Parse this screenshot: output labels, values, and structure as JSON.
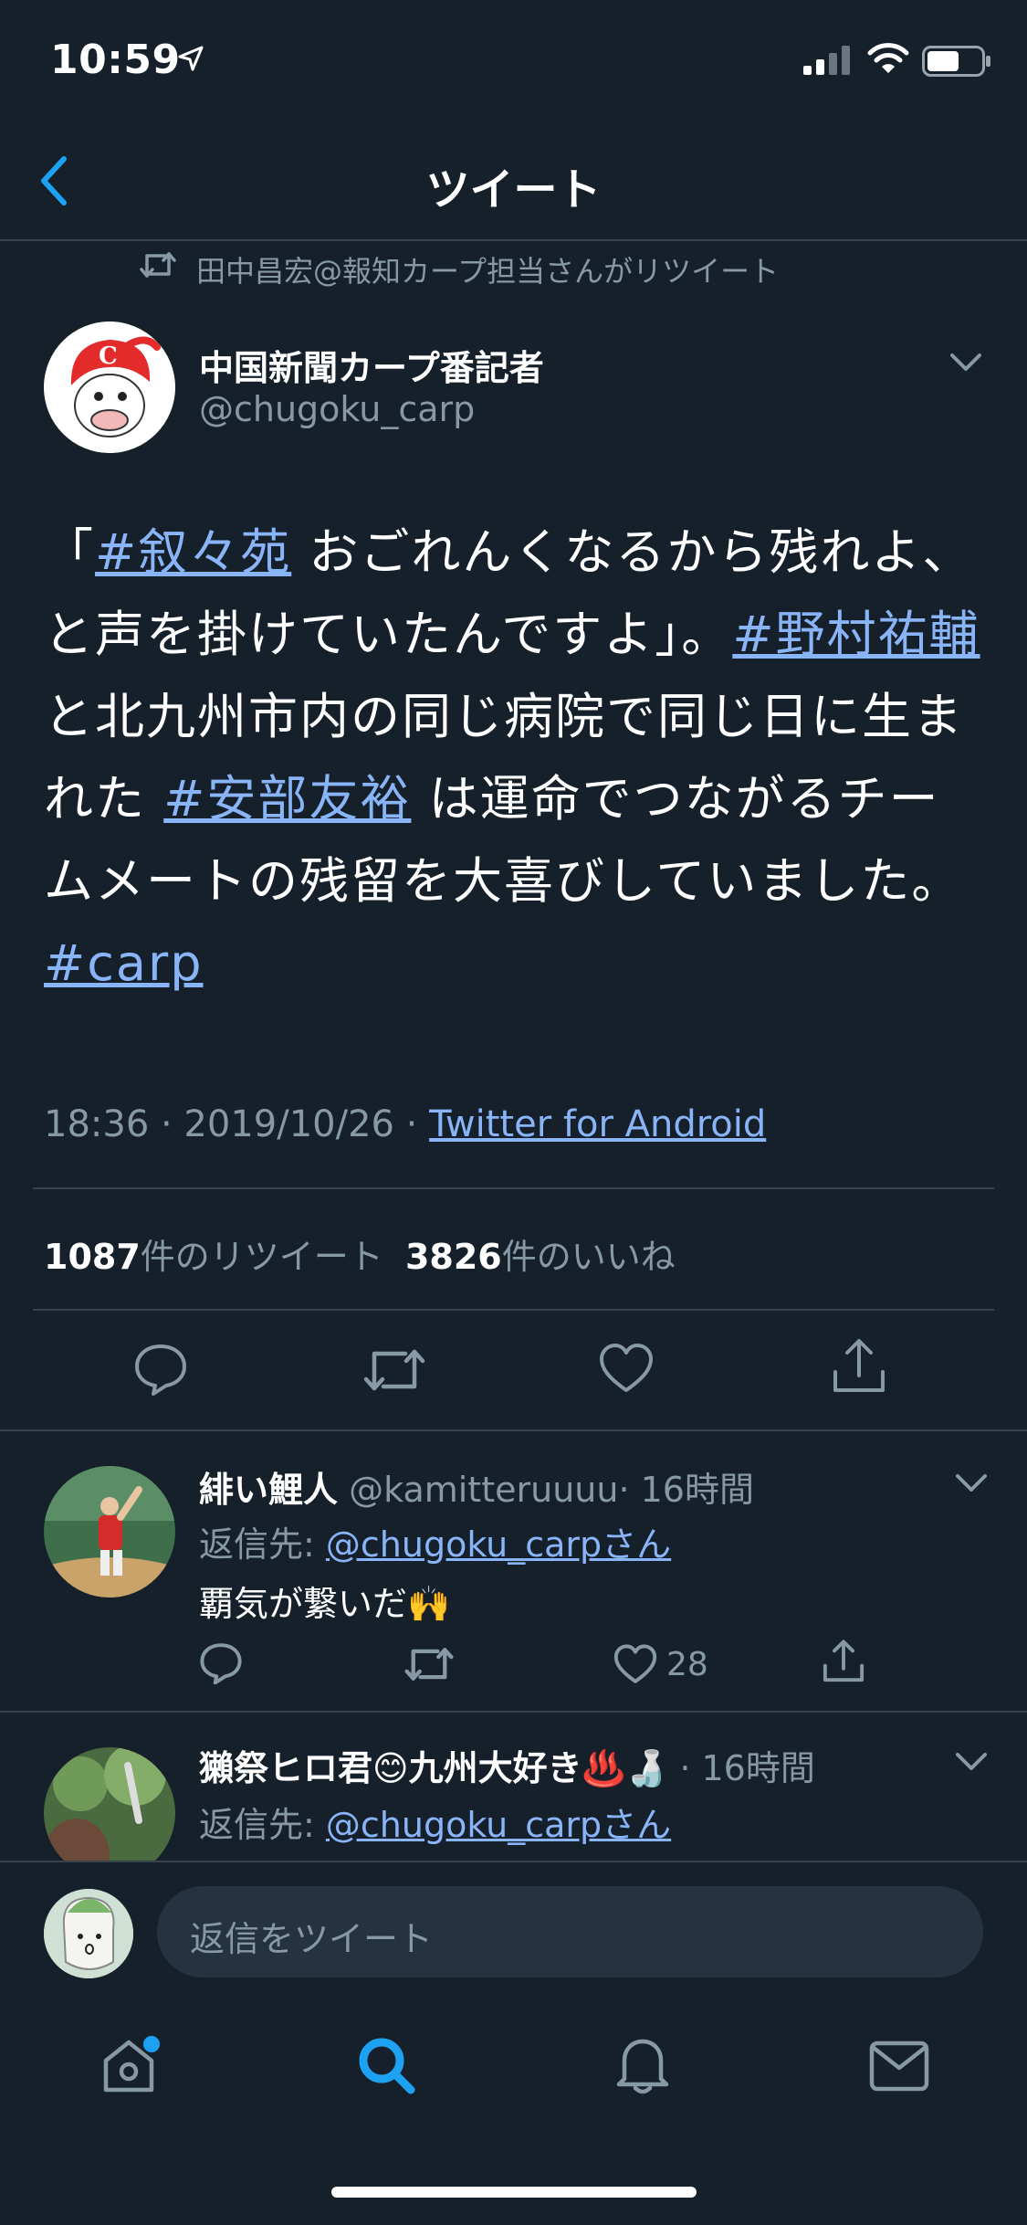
{
  "status_bar": {
    "time": "10:59"
  },
  "nav": {
    "title": "ツイート"
  },
  "retweet_header": {
    "text": "田中昌宏@報知カープ担当さんがリツイート"
  },
  "tweet": {
    "author_name": "中国新聞カープ番記者",
    "author_handle": "@chugoku_carp",
    "body": {
      "seg1": "「",
      "tag1": "#叙々苑",
      "seg2": " おごれんくなるから残れよ、と声を掛けていたんですよ」。",
      "tag2": "#野村祐輔",
      "seg3": " と北九州市内の同じ病院で同じ日に生まれた ",
      "tag3": "#安部友裕",
      "seg4": " は運命でつながるチームメートの残留を大喜びしていました。",
      "tag4": "#carp"
    },
    "meta_time": "18:36 · 2019/10/26 · ",
    "meta_source": "Twitter for Android",
    "retweet_count": "1087",
    "retweet_label": "件のリツイート",
    "like_count": "3826",
    "like_label": "件のいいね"
  },
  "replies": [
    {
      "name": "緋い鯉人",
      "handle": "@kamitteruuuu",
      "time": "· 16時間",
      "reply_to_label": "返信先: ",
      "reply_to": "@chugoku_carpさん",
      "text": "覇気が繋いだ🙌",
      "like_count": "28"
    },
    {
      "name": "獺祭ヒロ君😊九州大好き♨️🍶",
      "time": "· 16時間",
      "reply_to_label": "返信先: ",
      "reply_to": "@chugoku_carpさん"
    }
  ],
  "compose": {
    "placeholder": "返信をツイート"
  },
  "colors": {
    "background": "#15202b",
    "link": "#8ab4f8",
    "muted": "#8899a6",
    "divider": "#38444d",
    "accent": "#1da1f2"
  },
  "tab_bar": {
    "icons": [
      "home-icon",
      "search-icon",
      "notifications-icon",
      "messages-icon"
    ]
  }
}
